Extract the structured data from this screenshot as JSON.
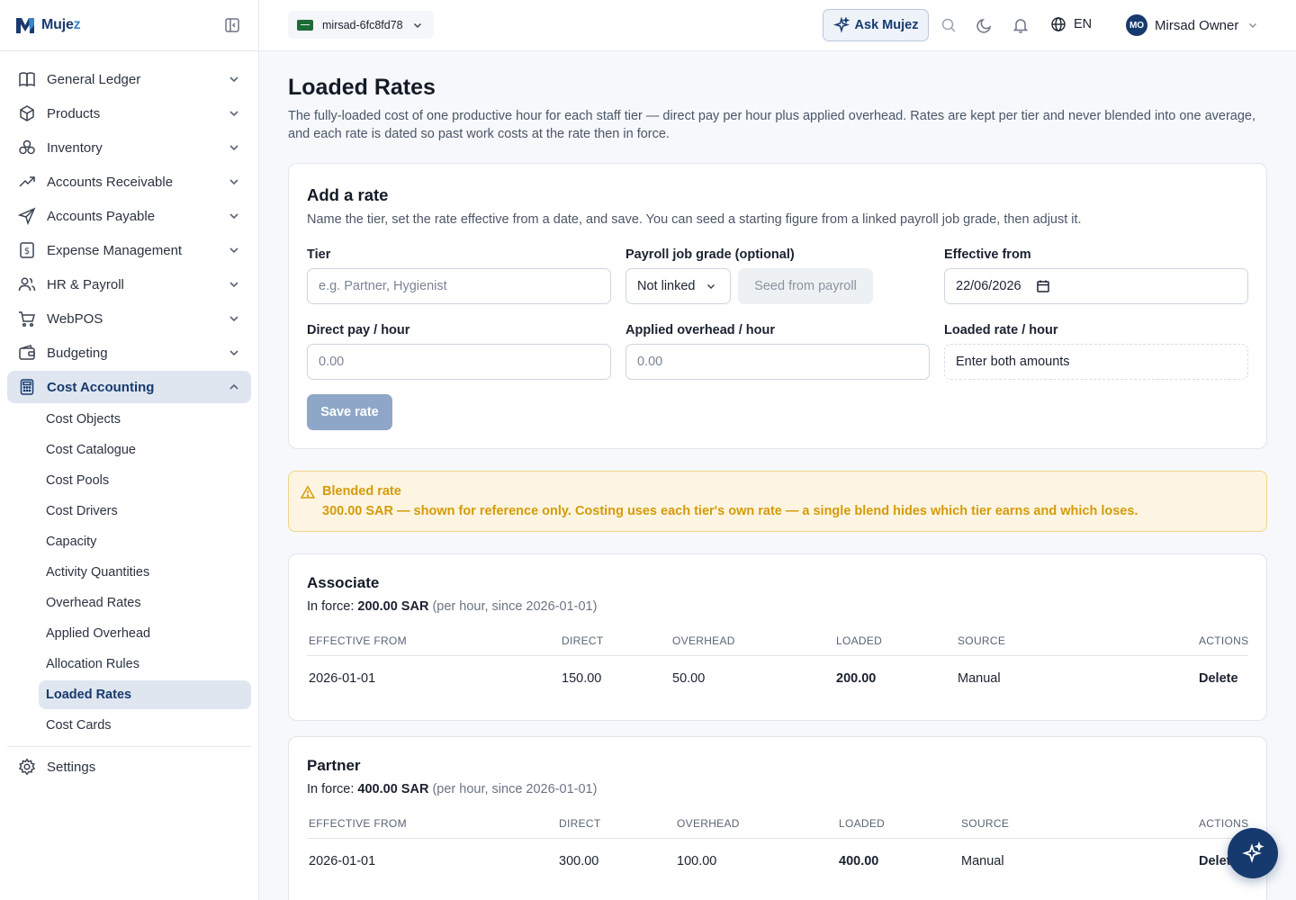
{
  "brand": {
    "name_main": "Muje",
    "name_accent": "z"
  },
  "sidebar": {
    "items": [
      {
        "label": "General Ledger",
        "icon": "book-icon"
      },
      {
        "label": "Products",
        "icon": "box-icon"
      },
      {
        "label": "Inventory",
        "icon": "boxes-icon"
      },
      {
        "label": "Accounts Receivable",
        "icon": "trending-up-icon"
      },
      {
        "label": "Accounts Payable",
        "icon": "send-icon"
      },
      {
        "label": "Expense Management",
        "icon": "receipt-icon"
      },
      {
        "label": "HR & Payroll",
        "icon": "users-icon"
      },
      {
        "label": "WebPOS",
        "icon": "cart-icon"
      },
      {
        "label": "Budgeting",
        "icon": "wallet-icon"
      },
      {
        "label": "Cost Accounting",
        "icon": "calculator-icon"
      }
    ],
    "subitems": [
      "Cost Objects",
      "Cost Catalogue",
      "Cost Pools",
      "Cost Drivers",
      "Capacity",
      "Activity Quantities",
      "Overhead Rates",
      "Applied Overhead",
      "Allocation Rules",
      "Loaded Rates",
      "Cost Cards"
    ],
    "settings": "Settings"
  },
  "topbar": {
    "company": "mirsad-6fc8fd78",
    "ask": "Ask Mujez",
    "lang": "EN",
    "avatar_initials": "MO",
    "user_name": "Mirsad Owner"
  },
  "page": {
    "title": "Loaded Rates",
    "description": "The fully-loaded cost of one productive hour for each staff tier — direct pay per hour plus applied overhead. Rates are kept per tier and never blended into one average, and each rate is dated so past work costs at the rate then in force."
  },
  "form": {
    "title": "Add a rate",
    "description": "Name the tier, set the rate effective from a date, and save. You can seed a starting figure from a linked payroll job grade, then adjust it.",
    "tier_label": "Tier",
    "tier_placeholder": "e.g. Partner, Hygienist",
    "grade_label": "Payroll job grade (optional)",
    "grade_value": "Not linked",
    "seed_label": "Seed from payroll",
    "effective_label": "Effective from",
    "effective_value": "22/06/2026",
    "direct_label": "Direct pay / hour",
    "direct_placeholder": "0.00",
    "overhead_label": "Applied overhead / hour",
    "overhead_placeholder": "0.00",
    "loaded_label": "Loaded rate / hour",
    "loaded_value": "Enter both amounts",
    "save_label": "Save rate"
  },
  "blended": {
    "title": "Blended rate",
    "text": "300.00 SAR — shown for reference only. Costing uses each tier's own rate — a single blend hides which tier earns and which loses."
  },
  "table_headers": [
    "EFFECTIVE FROM",
    "DIRECT",
    "OVERHEAD",
    "LOADED",
    "SOURCE",
    "ACTIONS"
  ],
  "tiers": [
    {
      "name": "Associate",
      "force_prefix": "In force: ",
      "force_amount": "200.00 SAR",
      "force_suffix": " (per hour, since 2026-01-01)",
      "row": {
        "effective": "2026-01-01",
        "direct": "150.00",
        "overhead": "50.00",
        "loaded": "200.00",
        "source": "Manual",
        "action": "Delete"
      }
    },
    {
      "name": "Partner",
      "force_prefix": "In force: ",
      "force_amount": "400.00 SAR",
      "force_suffix": " (per hour, since 2026-01-01)",
      "row": {
        "effective": "2026-01-01",
        "direct": "300.00",
        "overhead": "100.00",
        "loaded": "400.00",
        "source": "Manual",
        "action": "Delete"
      }
    }
  ]
}
